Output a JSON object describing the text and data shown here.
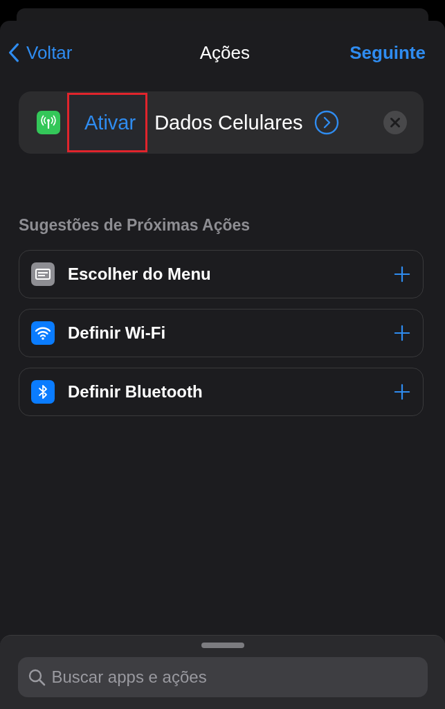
{
  "nav": {
    "back": "Voltar",
    "title": "Ações",
    "next": "Seguinte"
  },
  "action": {
    "verb": "Ativar",
    "verb_highlighted": true,
    "object": "Dados Celulares"
  },
  "section_title": "Sugestões de Próximas Ações",
  "suggestions": [
    {
      "kind": "menu",
      "label": "Escolher do Menu"
    },
    {
      "kind": "wifi",
      "label": "Definir Wi-Fi"
    },
    {
      "kind": "bluetooth",
      "label": "Definir Bluetooth"
    }
  ],
  "search": {
    "placeholder": "Buscar apps e ações"
  }
}
